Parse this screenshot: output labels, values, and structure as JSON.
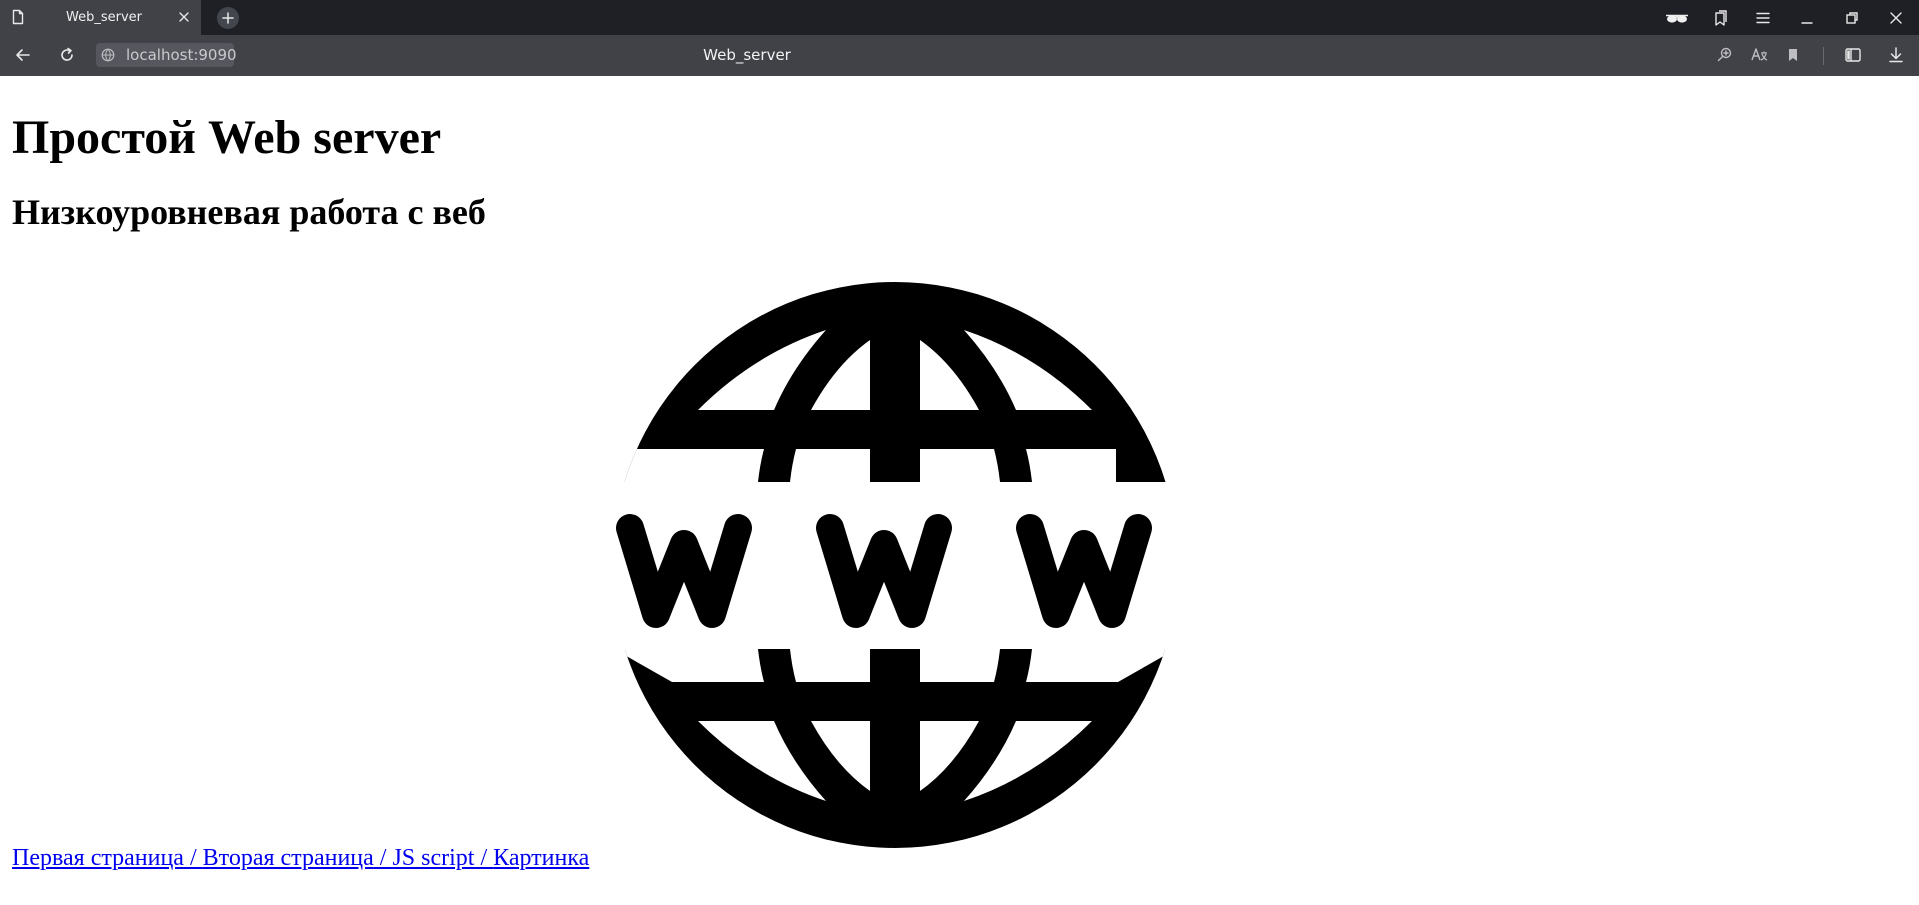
{
  "browser": {
    "tab": {
      "title": "Web_server"
    },
    "address_bar": {
      "url": "localhost:9090"
    },
    "page_caption": "Web_server",
    "icons": {
      "tab_page": "page-icon",
      "tab_close": "close-icon",
      "new_tab": "plus-icon",
      "reader": "glasses-icon",
      "bookmarks": "bookmarks-icon",
      "menu": "menu-icon",
      "minimize": "minimize-icon",
      "restore": "restore-icon",
      "close": "close-icon",
      "back": "back-arrow-icon",
      "reload": "reload-icon",
      "zoom": "zoom-icon",
      "translate": "translate-icon",
      "bookmark": "bookmark-icon",
      "sidebar": "sidebar-icon",
      "downloads": "download-icon"
    }
  },
  "page": {
    "heading": "Простой Web server",
    "subheading": "Низкоуровневая работа с веб",
    "image": {
      "icon": "www-globe-icon",
      "text": "www"
    },
    "nav": {
      "links": [
        {
          "label": "Первая страница"
        },
        {
          "label": "Вторая страница"
        },
        {
          "label": "JS script"
        },
        {
          "label": "Картинка"
        }
      ],
      "separator": " / "
    }
  },
  "colors": {
    "tabbar_bg": "#1f2026",
    "toolbar_bg": "#414248",
    "link": "#0000ee",
    "text": "#000000",
    "page_bg": "#ffffff"
  }
}
